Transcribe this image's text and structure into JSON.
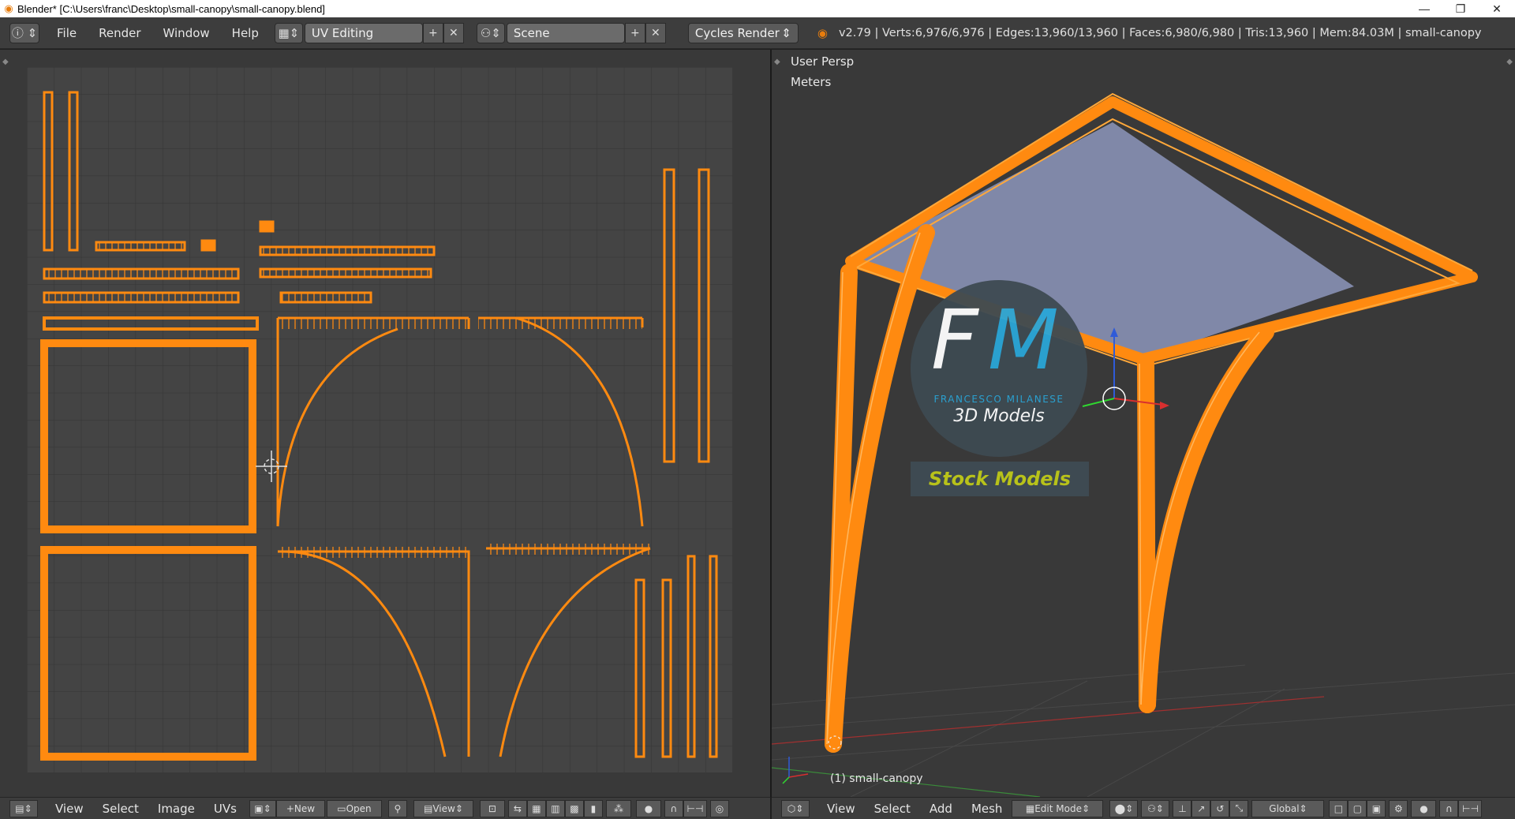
{
  "window": {
    "title": "Blender* [C:\\Users\\franc\\Desktop\\small-canopy\\small-canopy.blend]",
    "minimize": "—",
    "restore": "❐",
    "close": "✕"
  },
  "info_header": {
    "menus": [
      "File",
      "Render",
      "Window",
      "Help"
    ],
    "screen_layout": "UV Editing",
    "scene": "Scene",
    "render_engine": "Cycles Render",
    "stats": "v2.79 | Verts:6,976/6,976 | Edges:13,960/13,960 | Faces:6,980/6,980 | Tris:13,960 | Mem:84.03M | small-canopy"
  },
  "uv_editor": {
    "menus": [
      "View",
      "Select",
      "Image",
      "UVs"
    ],
    "new_label": "New",
    "open_label": "Open",
    "view_label": "View"
  },
  "viewport": {
    "view_name": "User Persp",
    "units": "Meters",
    "object_label": "(1) small-canopy",
    "menus": [
      "View",
      "Select",
      "Add",
      "Mesh"
    ],
    "mode": "Edit Mode",
    "orientation": "Global"
  },
  "watermark": {
    "letters_f": "F",
    "letters_m": "M",
    "author": "FRANCESCO MILANESE",
    "subtitle": "3D Models",
    "badge": "Stock Models"
  },
  "colors": {
    "uv_orange": "#ff8a10",
    "accent_blue": "#2aa6d8",
    "badge_text": "#b8c21a",
    "face_fill": "#8088a8"
  }
}
